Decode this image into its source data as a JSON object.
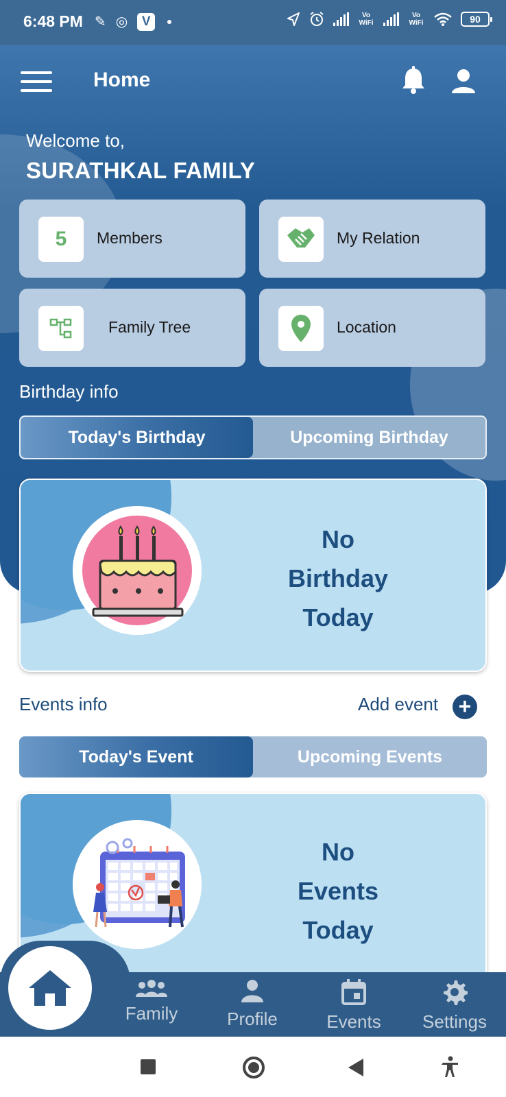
{
  "status_bar": {
    "time": "6:48 PM",
    "battery": "90",
    "vo_wifi_1": "Vo WiFi",
    "vo_wifi_2": "Vo WiFi"
  },
  "header": {
    "title": "Home",
    "welcome": "Welcome to,",
    "family_name": "SURATHKAL FAMILY"
  },
  "tiles": {
    "members_count": "5",
    "members_label": "Members",
    "relation_label": "My Relation",
    "tree_label": "Family Tree",
    "location_label": "Location"
  },
  "birthday": {
    "section_title": "Birthday info",
    "tab_today": "Today's Birthday",
    "tab_upcoming": "Upcoming Birthday",
    "msg_line1": "No",
    "msg_line2": "Birthday",
    "msg_line3": "Today"
  },
  "events": {
    "section_title": "Events info",
    "add_label": "Add event",
    "add_icon": "+",
    "tab_today": "Today's Event",
    "tab_upcoming": "Upcoming Events",
    "msg_line1": "No",
    "msg_line2": "Events",
    "msg_line3": "Today"
  },
  "bottom_nav": {
    "family": "Family",
    "profile": "Profile",
    "events": "Events",
    "settings": "Settings"
  },
  "colors": {
    "primary": "#235a91",
    "tile": "#b8cce2",
    "card": "#bddff2",
    "accent_green": "#66b26d",
    "text_dark_blue": "#1e4b7a"
  },
  "icons": [
    "menu-icon",
    "bell-icon",
    "user-icon",
    "handshake-icon",
    "tree-icon",
    "location-pin-icon",
    "cake-icon",
    "calendar-illustration",
    "home-icon",
    "family-icon",
    "profile-icon",
    "events-icon",
    "settings-icon"
  ]
}
